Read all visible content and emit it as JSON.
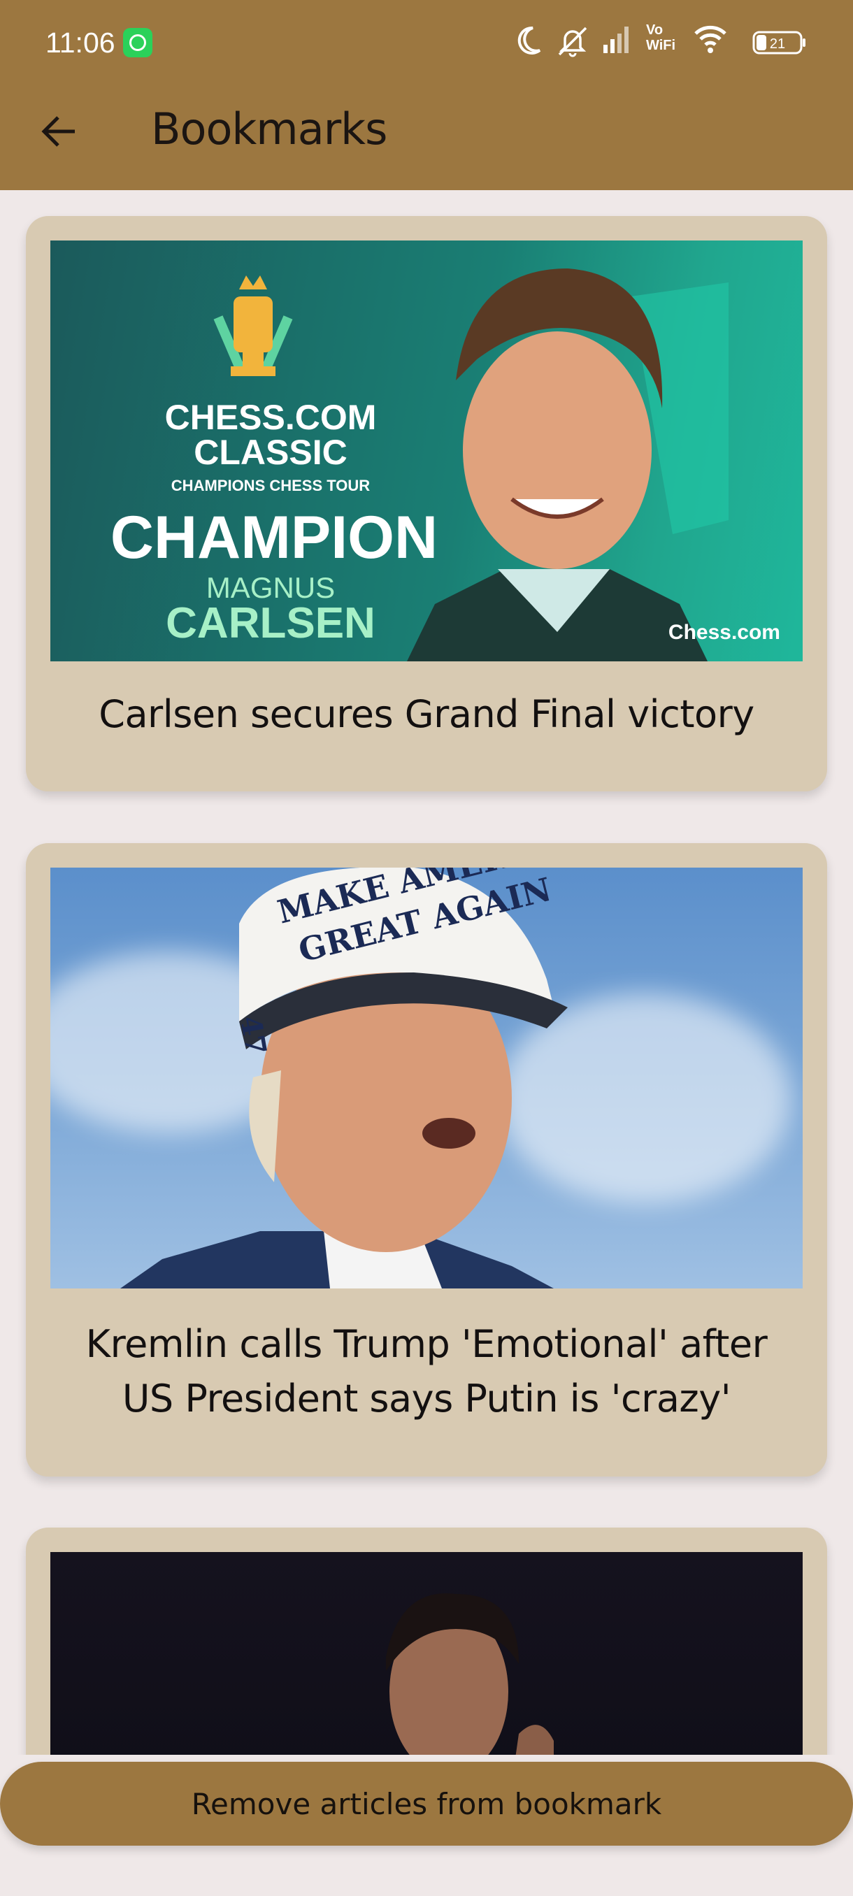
{
  "status_bar": {
    "time": "11:06",
    "vowifi_top": "Vo",
    "vowifi_bottom": "WiFi",
    "battery": "21"
  },
  "header": {
    "title": "Bookmarks",
    "back_icon": "arrow-left-icon"
  },
  "articles": [
    {
      "headline": "Carlsen secures Grand Final victory",
      "image": {
        "line1": "CHESS.COM",
        "line2": "CLASSIC",
        "line3": "CHAMPIONS CHESS TOUR",
        "line4": "CHAMPION",
        "line5": "MAGNUS",
        "line6": "CARLSEN",
        "brand": "Chess.com"
      }
    },
    {
      "headline_line1": "Kremlin calls Trump 'Emotional' after",
      "headline_line2": "US President says Putin is 'crazy'",
      "image": {
        "cap_line1": "MAKE AMERICA",
        "cap_line2": "GREAT AGAIN",
        "cap_side": "47"
      }
    },
    {
      "headline": ""
    }
  ],
  "actions": {
    "remove_label": "Remove articles from bookmark"
  },
  "colors": {
    "header": "#9C7740",
    "card": "#D8CAB2",
    "background": "#EFE8E8"
  }
}
